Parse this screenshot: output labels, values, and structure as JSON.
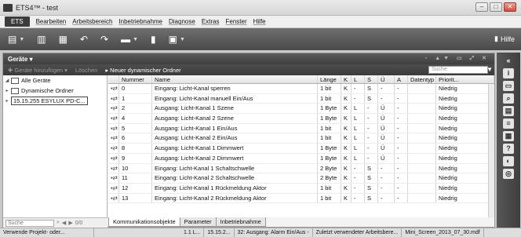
{
  "window": {
    "title": "ETS4™ - test",
    "controls": [
      "–",
      "□",
      "✕"
    ]
  },
  "menu": {
    "ets": "ETS",
    "items": [
      "Bearbeiten",
      "Arbeitsbereich",
      "Inbetriebnahme",
      "Diagnose",
      "Extras",
      "Fenster",
      "Hilfe"
    ]
  },
  "toolbar": {
    "help": "Hilfe"
  },
  "panel": {
    "title": "Geräte ▾",
    "add_devices": "Geräte hinzufügen",
    "delete": "Löschen",
    "new_folder": "Neuer dynamischer Ordner",
    "search_placeholder": "Suche"
  },
  "tree": {
    "items": [
      "Alle Geräte",
      "Dynamische Ordner",
      "15.15.255  ESYLUX PD-C..."
    ],
    "search_placeholder": "Suche",
    "count": "0/0"
  },
  "table": {
    "headers": [
      "",
      "Nummer",
      "Name",
      "Länge",
      "K",
      "L",
      "S",
      "Ü",
      "A",
      "Datentyp",
      "Priorit..."
    ],
    "rows": [
      {
        "num": "0",
        "name": "Eingang: Licht-Kanal sperren",
        "len": "1 bit",
        "k": "K",
        "l": "-",
        "s": "S",
        "u": "-",
        "a": "-",
        "dt": "",
        "pr": "Niedrig"
      },
      {
        "num": "1",
        "name": "Eingang: Licht-Kanal manuell Ein/Aus",
        "len": "1 bit",
        "k": "K",
        "l": "-",
        "s": "S",
        "u": "-",
        "a": "-",
        "dt": "",
        "pr": "Niedrig"
      },
      {
        "num": "2",
        "name": "Ausgang: Licht-Kanal 1 Szene",
        "len": "1 Byte",
        "k": "K",
        "l": "L",
        "s": "-",
        "u": "Ü",
        "a": "-",
        "dt": "",
        "pr": "Niedrig"
      },
      {
        "num": "4",
        "name": "Ausgang: Licht-Kanal 2 Szene",
        "len": "1 Byte",
        "k": "K",
        "l": "L",
        "s": "-",
        "u": "Ü",
        "a": "-",
        "dt": "",
        "pr": "Niedrig"
      },
      {
        "num": "5",
        "name": "Ausgang: Licht-Kanal 1 Ein/Aus",
        "len": "1 bit",
        "k": "K",
        "l": "L",
        "s": "-",
        "u": "Ü",
        "a": "-",
        "dt": "",
        "pr": "Niedrig"
      },
      {
        "num": "6",
        "name": "Ausgang: Licht-Kanal 2 Ein/Aus",
        "len": "1 bit",
        "k": "K",
        "l": "L",
        "s": "-",
        "u": "Ü",
        "a": "-",
        "dt": "",
        "pr": "Niedrig"
      },
      {
        "num": "8",
        "name": "Ausgang: Licht-Kanal 1 Dimmwert",
        "len": "1 Byte",
        "k": "K",
        "l": "L",
        "s": "-",
        "u": "Ü",
        "a": "-",
        "dt": "",
        "pr": "Niedrig"
      },
      {
        "num": "9",
        "name": "Ausgang: Licht-Kanal 2 Dimmwert",
        "len": "1 Byte",
        "k": "K",
        "l": "L",
        "s": "-",
        "u": "Ü",
        "a": "-",
        "dt": "",
        "pr": "Niedrig"
      },
      {
        "num": "10",
        "name": "Eingang: Licht-Kanal 1 Schaltschwelle",
        "len": "2 Byte",
        "k": "K",
        "l": "-",
        "s": "S",
        "u": "-",
        "a": "-",
        "dt": "",
        "pr": "Niedrig"
      },
      {
        "num": "11",
        "name": "Eingang: Licht-Kanal 2 Schaltschwelle",
        "len": "2 Byte",
        "k": "K",
        "l": "-",
        "s": "S",
        "u": "-",
        "a": "-",
        "dt": "",
        "pr": "Niedrig"
      },
      {
        "num": "12",
        "name": "Eingang: Licht-Kanal 1 Rückmeldung Aktor",
        "len": "1 bit",
        "k": "K",
        "l": "-",
        "s": "S",
        "u": "-",
        "a": "-",
        "dt": "",
        "pr": "Niedrig"
      },
      {
        "num": "13",
        "name": "Eingang: Licht-Kanal 2 Rückmeldung Aktor",
        "len": "1 bit",
        "k": "K",
        "l": "-",
        "s": "S",
        "u": "-",
        "a": "-",
        "dt": "",
        "pr": "Niedrig"
      }
    ]
  },
  "tabs": [
    "Kommunikationsobjekte",
    "Parameter",
    "Inbetriebnahme"
  ],
  "status": [
    "Verwende Projekt- oder...",
    "1.1 L...",
    "15.15.2...",
    "32: Ausgang: Alarm Ein/Aus -",
    "Zuletzt verwendeter Arbeitsbere...",
    "Mini_Screen_2013_07_30.mdf"
  ]
}
